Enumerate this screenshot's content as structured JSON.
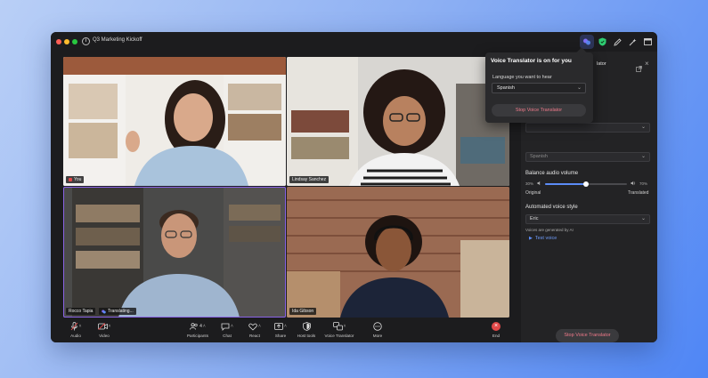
{
  "window": {
    "title": "Q3 Marketing Kickoff"
  },
  "colors": {
    "accent": "#8a63e6",
    "danger": "#e24848",
    "shield": "#2ecc71",
    "stop_text": "#f07a8a"
  },
  "participants": [
    {
      "name": "You",
      "muted": true
    },
    {
      "name": "Lindsay Sanchez"
    },
    {
      "name": "Rocco Tapia",
      "status": "Translating..."
    },
    {
      "name": "Ida Gibson"
    }
  ],
  "popover": {
    "title": "Voice Translator is on for you",
    "language_label": "Language you want to hear",
    "language_value": "Spanish",
    "stop_button": "Stop Voice Translator"
  },
  "panel": {
    "title_partial": "lator",
    "spoken_value": "Spanish",
    "balance_label": "Balance audio volume",
    "left_pct": "30%",
    "right_pct": "70%",
    "original_label": "Original",
    "translated_label": "Translated",
    "balance_level": 0.5,
    "voice_style_label": "Automated voice style",
    "voice_style_value": "Eric",
    "ai_note": "Voices are generated by AI",
    "test_voice": "Test voice",
    "stop_button": "Stop Voice Translator"
  },
  "toolbar": {
    "audio": "Audio",
    "video": "Video",
    "participants": "Participants",
    "participants_count": "4",
    "chat": "Chat",
    "react": "React",
    "share": "Share",
    "host_tools": "Host tools",
    "voice_translator": "Voice Translator",
    "more": "More",
    "end": "End"
  }
}
